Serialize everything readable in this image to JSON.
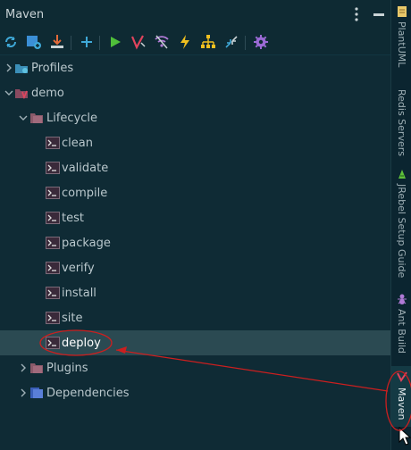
{
  "window": {
    "title": "Maven"
  },
  "toolbar": {
    "buttons": [
      {
        "icon": "reload-icon"
      },
      {
        "icon": "generate-sources-icon"
      },
      {
        "icon": "download-icon"
      },
      {
        "icon": "add-icon"
      },
      {
        "icon": "run-icon"
      },
      {
        "icon": "maven-goal-icon"
      },
      {
        "icon": "toggle-offline-icon"
      },
      {
        "icon": "skip-tests-icon"
      },
      {
        "icon": "show-dependencies-icon"
      },
      {
        "icon": "collapse-all-icon"
      },
      {
        "icon": "settings-icon"
      }
    ]
  },
  "tree": {
    "profiles": "Profiles",
    "project": "demo",
    "lifecycle": "Lifecycle",
    "goals": [
      "clean",
      "validate",
      "compile",
      "test",
      "package",
      "verify",
      "install",
      "site",
      "deploy"
    ],
    "plugins": "Plugins",
    "dependencies": "Dependencies",
    "selected": "deploy"
  },
  "sidebar": {
    "tabs": [
      {
        "label": "PlantUML",
        "icon": "plantuml-icon"
      },
      {
        "label": "Redis Servers",
        "icon": ""
      },
      {
        "label": "JRebel Setup Guide",
        "icon": "jrebel-icon"
      },
      {
        "label": "Ant Build",
        "icon": "ant-icon"
      },
      {
        "label": "Maven",
        "icon": "maven-icon",
        "active": true
      }
    ]
  },
  "colors": {
    "background": "#0f2b35",
    "selection": "#2b4a52",
    "annotation": "#cc1f1f",
    "folder": "#8a5a6a"
  }
}
